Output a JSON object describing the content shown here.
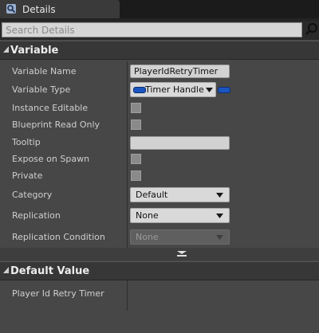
{
  "tab": {
    "title": "Details",
    "icon": "magnifier-icon"
  },
  "search": {
    "placeholder": "Search Details",
    "value": "",
    "icon": "search-icon"
  },
  "sections": {
    "variable": {
      "title": "Variable"
    },
    "default_value": {
      "title": "Default Value"
    }
  },
  "variable": {
    "name_label": "Variable Name",
    "name_value": "PlayerIdRetryTimer",
    "type_label": "Variable Type",
    "type_value": "Timer Handle",
    "type_pin_color": "#1a55c0",
    "instance_editable_label": "Instance Editable",
    "instance_editable_checked": false,
    "blueprint_read_only_label": "Blueprint Read Only",
    "blueprint_read_only_checked": false,
    "tooltip_label": "Tooltip",
    "tooltip_value": "",
    "expose_on_spawn_label": "Expose on Spawn",
    "expose_on_spawn_checked": false,
    "private_label": "Private",
    "private_checked": false,
    "category_label": "Category",
    "category_value": "Default",
    "replication_label": "Replication",
    "replication_value": "None",
    "replication_condition_label": "Replication Condition",
    "replication_condition_value": "None",
    "replication_condition_enabled": false
  },
  "default_value": {
    "player_id_retry_timer_label": "Player Id Retry Timer"
  },
  "colors": {
    "panel_bg": "#474747",
    "header_bg": "#373737",
    "tab_bg": "#3a3a3a",
    "accent_blue": "#1a55c0"
  }
}
